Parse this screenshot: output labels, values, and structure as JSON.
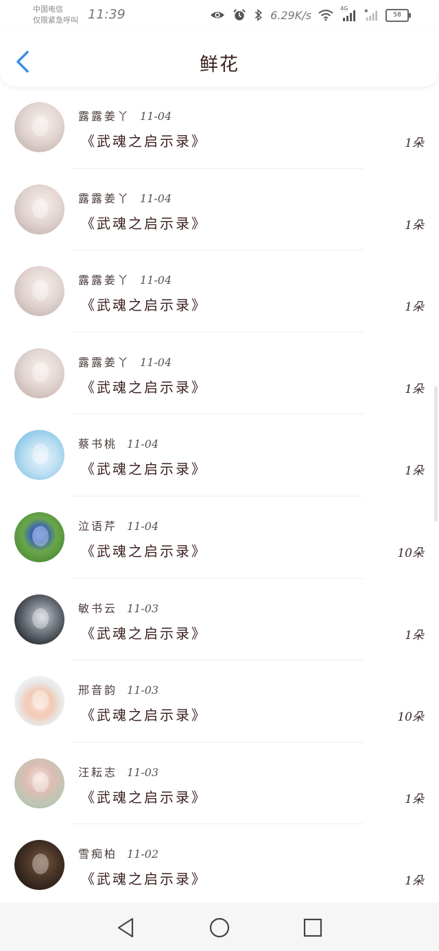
{
  "status_bar": {
    "carrier_line1": "中国电信",
    "carrier_line2": "仅限紧急呼叫",
    "time": "11:39",
    "net_speed": "6.29K/s",
    "signal_label": "4G",
    "battery": "58"
  },
  "header": {
    "title": "鲜花"
  },
  "records": [
    {
      "name": "露露姜丫",
      "date": "11-04",
      "book": "《武魂之启示录》",
      "amount": "1朵",
      "avatar": "a-girl"
    },
    {
      "name": "露露姜丫",
      "date": "11-04",
      "book": "《武魂之启示录》",
      "amount": "1朵",
      "avatar": "a-girl"
    },
    {
      "name": "露露姜丫",
      "date": "11-04",
      "book": "《武魂之启示录》",
      "amount": "1朵",
      "avatar": "a-girl"
    },
    {
      "name": "露露姜丫",
      "date": "11-04",
      "book": "《武魂之启示录》",
      "amount": "1朵",
      "avatar": "a-girl"
    },
    {
      "name": "蔡书桃",
      "date": "11-04",
      "book": "《武魂之启示录》",
      "amount": "1朵",
      "avatar": "a-seal"
    },
    {
      "name": "泣语芹",
      "date": "11-04",
      "book": "《武魂之启示录》",
      "amount": "10朵",
      "avatar": "a-kid"
    },
    {
      "name": "敏书云",
      "date": "11-03",
      "book": "《武魂之启示录》",
      "amount": "1朵",
      "avatar": "a-dark"
    },
    {
      "name": "邢音韵",
      "date": "11-03",
      "book": "《武魂之启示录》",
      "amount": "10朵",
      "avatar": "a-toon"
    },
    {
      "name": "汪耘志",
      "date": "11-03",
      "book": "《武魂之启示录》",
      "amount": "1朵",
      "avatar": "a-glass"
    },
    {
      "name": "雪痴柏",
      "date": "11-02",
      "book": "《武魂之启示录》",
      "amount": "1朵",
      "avatar": "a-night"
    }
  ],
  "icons": {
    "back": "back-arrow-icon",
    "eye": "eye-icon",
    "alarm": "alarm-icon",
    "bluetooth": "bluetooth-icon",
    "wifi": "wifi-icon",
    "signal": "signal-icon",
    "battery": "battery-icon",
    "nav_back": "nav-back-icon",
    "nav_home": "nav-home-icon",
    "nav_recent": "nav-recent-icon"
  },
  "colors": {
    "accent": "#3a8ee6",
    "title": "#3a1f1f",
    "nav_bg": "#f6f6f6"
  }
}
